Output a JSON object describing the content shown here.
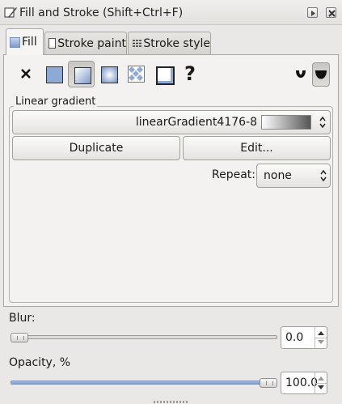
{
  "window": {
    "title": "Fill and Stroke (Shift+Ctrl+F)"
  },
  "tabs": [
    {
      "label": "Fill",
      "active": true
    },
    {
      "label": "Stroke paint",
      "active": false
    },
    {
      "label": "Stroke style",
      "active": false
    }
  ],
  "paint_types": {
    "selected": "linear-gradient",
    "items": [
      "no-paint",
      "flat-color",
      "linear-gradient",
      "radial-gradient",
      "pattern",
      "swatch",
      "unset"
    ],
    "unset_glyph": "?"
  },
  "fill_rule": {
    "selected": "nonzero"
  },
  "gradient": {
    "section_label": "Linear gradient",
    "selected_name": "linearGradient4176-8",
    "duplicate_label": "Duplicate",
    "edit_label": "Edit...",
    "repeat_label": "Repeat:",
    "repeat_value": "none"
  },
  "blur": {
    "label": "Blur:",
    "value": "0.0",
    "fraction": 0.0
  },
  "opacity": {
    "label": "Opacity, %",
    "value": "100.0",
    "fraction": 1.0
  },
  "colors": {
    "accent": "#7e9acb",
    "panel": "#f3f2f0"
  }
}
